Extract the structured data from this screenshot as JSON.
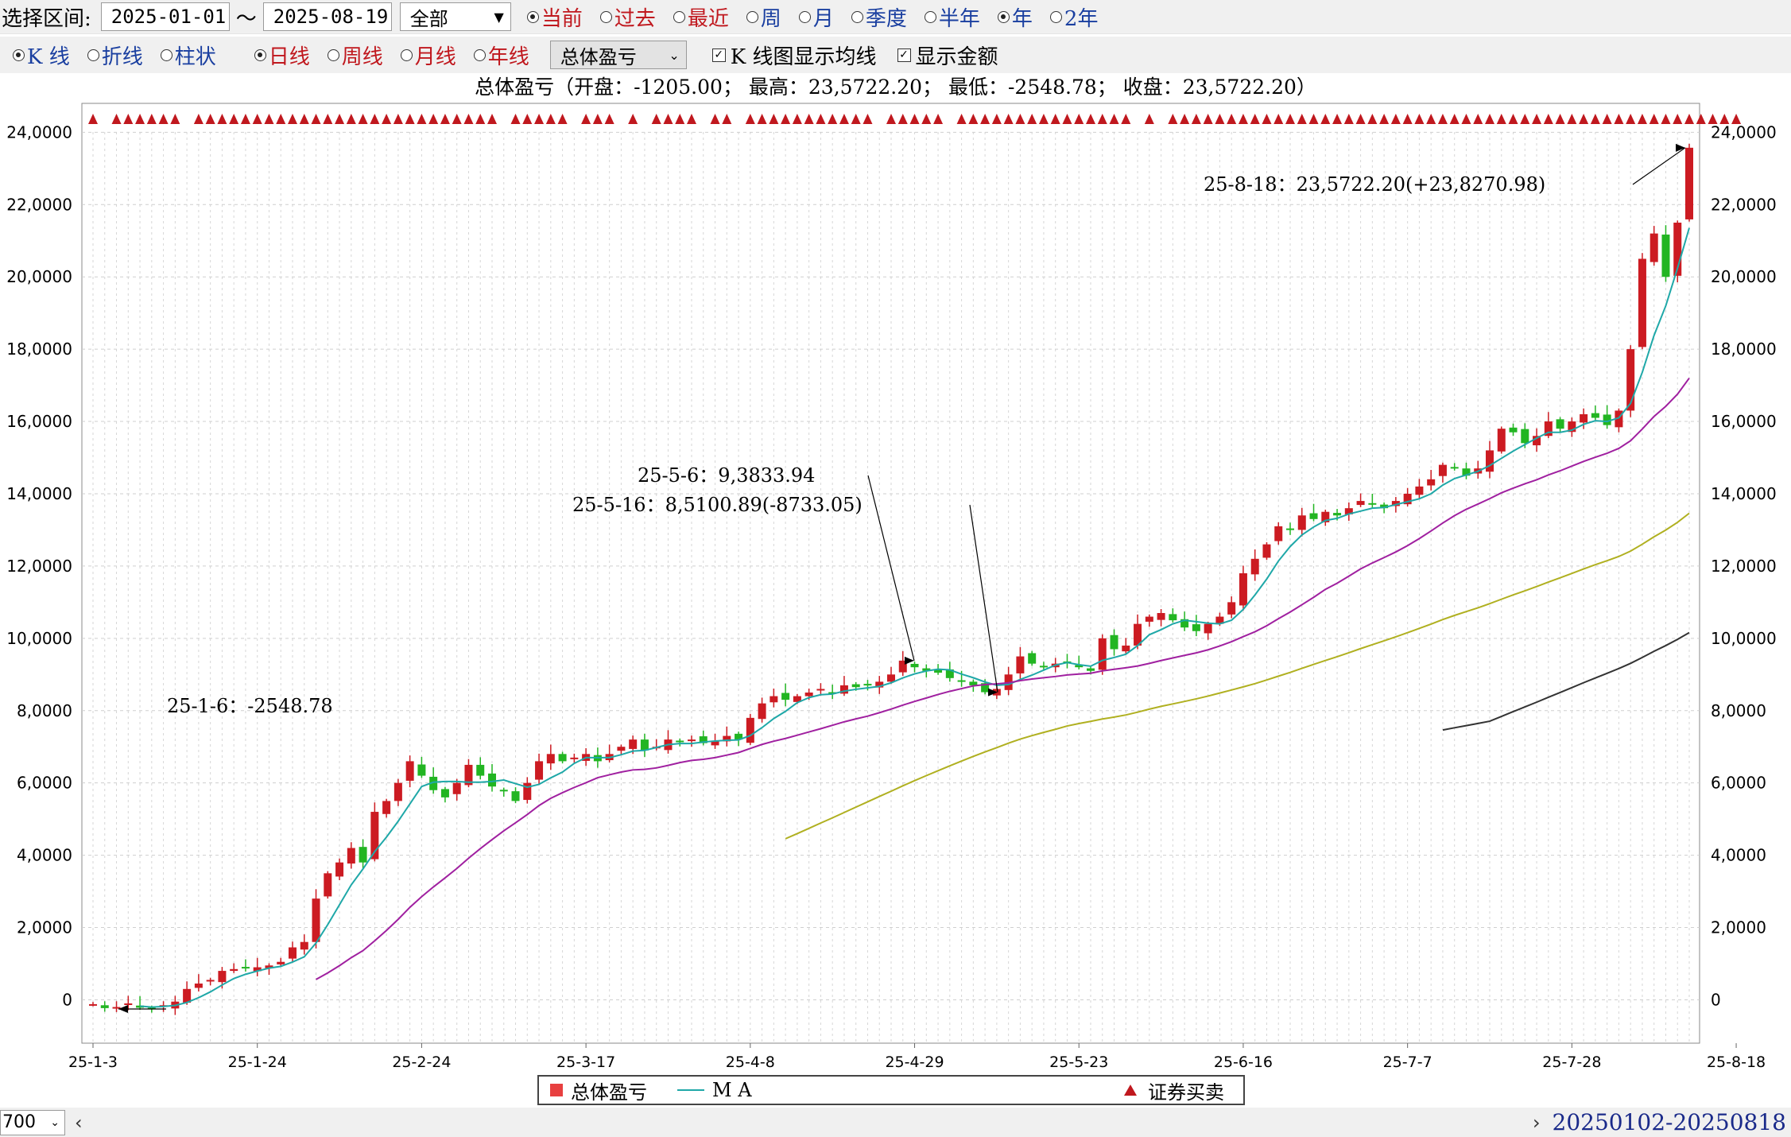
{
  "toolbar": {
    "range_label": "选择区间:",
    "start_date": "2025-01-01",
    "tilde": "～",
    "end_date": "2025-08-19",
    "account_select": "全部",
    "period_options": [
      {
        "label": "当前",
        "selected": true
      },
      {
        "label": "过去",
        "selected": false
      },
      {
        "label": "最近",
        "selected": false
      },
      {
        "label": "周",
        "selected": false
      },
      {
        "label": "月",
        "selected": false
      },
      {
        "label": "季度",
        "selected": false
      },
      {
        "label": "半年",
        "selected": false
      },
      {
        "label": "年",
        "selected": true
      },
      {
        "label": "2年",
        "selected": false
      }
    ]
  },
  "chart_options": {
    "chart_types": [
      {
        "label": "K 线",
        "selected": true
      },
      {
        "label": "折线",
        "selected": false
      },
      {
        "label": "柱状",
        "selected": false
      }
    ],
    "periods": [
      {
        "label": "日线",
        "selected": true
      },
      {
        "label": "周线",
        "selected": false
      },
      {
        "label": "月线",
        "selected": false
      },
      {
        "label": "年线",
        "selected": false
      }
    ],
    "metric_select": "总体盈亏",
    "show_ma_label": "K 线图显示均线",
    "show_ma_checked": true,
    "show_amount_label": "显示金额",
    "show_amount_checked": true
  },
  "summary": "总体盈亏（开盘：-1205.00； 最高：23,5722.20； 最低：-2548.78； 收盘：23,5722.20）",
  "legend": {
    "candle_label": "总体盈亏",
    "ma_label": "M A",
    "trade_label": "证券买卖"
  },
  "bottom": {
    "zoom": "700",
    "range_text": "20250102-20250818"
  },
  "colors": {
    "up": "#cc1b22",
    "down": "#22b522",
    "ma5": "#1fa8a8",
    "ma20": "#a020a0",
    "ma60": "#b0b020",
    "ma120": "#333333",
    "trade_marker": "#c0181e"
  },
  "chart_data": {
    "type": "candlestick",
    "title": "总体盈亏",
    "y_axis_label_format": "万位分隔",
    "ylim": [
      -1200,
      24800
    ],
    "y_ticks": [
      0,
      20000,
      40000,
      60000,
      80000,
      100000,
      120000,
      140000,
      160000,
      180000,
      200000,
      220000,
      240000
    ],
    "y_tick_labels": [
      "0",
      "2,0000",
      "4,0000",
      "6,0000",
      "8,0000",
      "10,0000",
      "12,0000",
      "14,0000",
      "16,0000",
      "18,0000",
      "20,0000",
      "22,0000",
      "24,0000"
    ],
    "x_tick_labels": [
      {
        "index": 0,
        "label": "25-1-3"
      },
      {
        "index": 14,
        "label": "25-1-24"
      },
      {
        "index": 28,
        "label": "25-2-24"
      },
      {
        "index": 42,
        "label": "25-3-17"
      },
      {
        "index": 56,
        "label": "25-4-8"
      },
      {
        "index": 70,
        "label": "25-4-29"
      },
      {
        "index": 84,
        "label": "25-5-23"
      },
      {
        "index": 98,
        "label": "25-6-16"
      },
      {
        "index": 112,
        "label": "25-7-7"
      },
      {
        "index": 126,
        "label": "25-7-28"
      },
      {
        "index": 140,
        "label": "25-8-18"
      }
    ],
    "series_close": [
      -1205,
      -2300,
      -2000,
      -1000,
      -2200,
      -2548.78,
      -1500,
      -500,
      3000,
      4500,
      5500,
      8000,
      8500,
      8800,
      9000,
      9500,
      10500,
      14500,
      16000,
      28000,
      35000,
      38000,
      42000,
      38000,
      52000,
      55000,
      60000,
      66000,
      62000,
      58000,
      56000,
      60000,
      65000,
      62000,
      59000,
      58000,
      55000,
      60000,
      66000,
      68000,
      66000,
      67000,
      68000,
      66000,
      68000,
      70000,
      72000,
      69000,
      70000,
      72000,
      71500,
      72000,
      71000,
      71500,
      73000,
      72000,
      78000,
      82000,
      84000,
      83000,
      84000,
      85000,
      86000,
      85000,
      87000,
      86500,
      87000,
      88000,
      90000,
      93833.94,
      92000,
      91000,
      90500,
      89000,
      88000,
      87000,
      85100.89,
      86000,
      90000,
      95000,
      93000,
      92000,
      93000,
      93500,
      92000,
      91000,
      100000,
      97000,
      98000,
      104000,
      106000,
      107000,
      105000,
      103000,
      102000,
      104000,
      106000,
      110000,
      118000,
      122000,
      126000,
      131000,
      130000,
      134000,
      133000,
      135000,
      134000,
      136000,
      138000,
      137000,
      136000,
      138000,
      140000,
      142000,
      144000,
      148000,
      147000,
      145000,
      147000,
      152000,
      158000,
      157000,
      154000,
      156000,
      160000,
      158000,
      160000,
      162000,
      161000,
      159000,
      163000,
      180000,
      205000,
      212000,
      200000,
      215000,
      235722.2
    ],
    "candles_sample_note": "开高低收逐日取自图形",
    "ma_lines": [
      {
        "name": "MA5",
        "start_index": 4
      },
      {
        "name": "MA20",
        "start_index": 19
      },
      {
        "name": "MA60",
        "start_index": 59
      },
      {
        "name": "MA120",
        "start_index": 115
      }
    ],
    "annotations": [
      {
        "label": "25-8-18：23,5722.20(+23,8270.98)",
        "index": 140,
        "value": 235722.2
      },
      {
        "label": "25-5-6：9,3833.94",
        "index": 69,
        "value": 93833.94
      },
      {
        "label": "25-5-16：8,5100.89(-8733.05)",
        "index": 76,
        "value": 85100.89
      },
      {
        "label": "25-1-6：-2548.78",
        "index": 5,
        "value": -2548.78
      }
    ],
    "trade_marker_runs": [
      [
        0,
        0
      ],
      [
        2,
        7
      ],
      [
        9,
        34
      ],
      [
        36,
        40
      ],
      [
        42,
        44
      ],
      [
        46,
        46
      ],
      [
        48,
        51
      ],
      [
        53,
        54
      ],
      [
        56,
        66
      ],
      [
        68,
        72
      ],
      [
        74,
        88
      ],
      [
        90,
        90
      ],
      [
        92,
        140
      ]
    ]
  }
}
